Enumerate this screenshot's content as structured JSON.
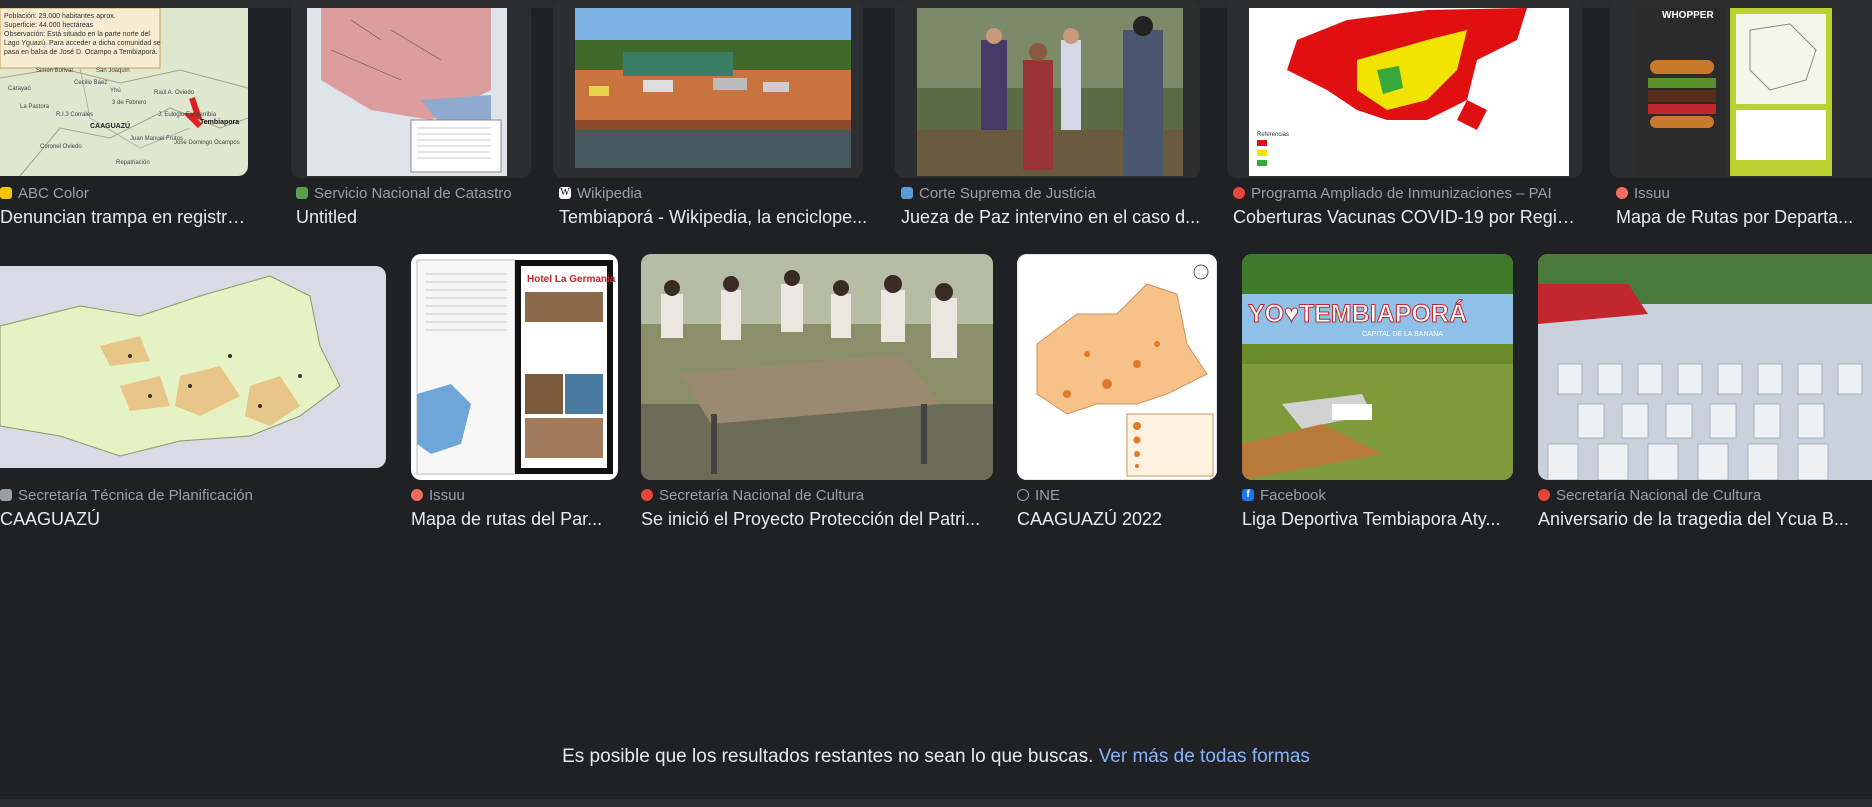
{
  "results_row1": [
    {
      "source": "ABC Color",
      "title": "Denuncian trampa en registro ...",
      "favicon_color": "#f5c400"
    },
    {
      "source": "Servicio Nacional de Catastro",
      "title": "Untitled",
      "favicon_color": "#5aa04a"
    },
    {
      "source": "Wikipedia",
      "title": "Tembiaporá - Wikipedia, la enciclope...",
      "favicon_color": "#ffffff"
    },
    {
      "source": "Corte Suprema de Justicia",
      "title": "Jueza de Paz intervino en el caso d...",
      "favicon_color": "#5b9bd5"
    },
    {
      "source": "Programa Ampliado de Inmunizaciones – PAI",
      "title": "Coberturas Vacunas COVID-19 por Region...",
      "favicon_color": "#e8453c"
    },
    {
      "source": "Issuu",
      "title": "Mapa de Rutas por Departa...",
      "favicon_color": "#f36d5d"
    }
  ],
  "results_row2": [
    {
      "source": "Secretaría Técnica de Planificación",
      "title": "CAAGUAZÚ",
      "favicon_color": "#9aa0a6"
    },
    {
      "source": "Issuu",
      "title": "Mapa de rutas del Par...",
      "favicon_color": "#f36d5d"
    },
    {
      "source": "Secretaría Nacional de Cultura",
      "title": "Se inició el Proyecto Protección del Patri...",
      "favicon_color": "#e8453c"
    },
    {
      "source": "INE",
      "title": "CAAGUAZÚ 2022",
      "favicon_color": "#9aa0a6"
    },
    {
      "source": "Facebook",
      "title": "Liga Deportiva Tembiapora Aty...",
      "favicon_color": "#1877f2"
    },
    {
      "source": "Secretaría Nacional de Cultura",
      "title": "Aniversario de la tragedia del Ycua B...",
      "favicon_color": "#e8453c"
    }
  ],
  "thumb_text": {
    "map1_city": "Tembiapora",
    "map1_info": [
      "Población: 29.000 habitantes aprox.",
      "Superficie: 44.000 hectáreas",
      "Observación: Está situado en la parte norte del",
      "Lago Yguazú. Para acceder a dicha comunidad se",
      "pasa en balsa de José D. Ocampo a Tembiaporá."
    ],
    "map1_places": [
      "Simón Bolívar",
      "Cecilio Báez",
      "San Joaquín",
      "Yhú",
      "3 de Febrero",
      "R.I.3 Corrales",
      "CAAGUAZÚ",
      "Raúl A. Oviedo",
      "Repatriación",
      "Coronel Oviedo",
      "Juan Manuel Frutos",
      "J. Eulogio Estigarribia",
      "José Domingo Ocampos",
      "La Pastora",
      "Carayaó"
    ],
    "sign_text": "YO♥TEMBIAPORÁ",
    "sign_sub": "CAPITAL DE LA BANANA",
    "brochure_title": "Hotel La Germania",
    "burger_title": "WHOPPER"
  },
  "footer": {
    "text": "Es posible que los resultados restantes no sean lo que buscas.",
    "link": "Ver más de todas formas"
  }
}
